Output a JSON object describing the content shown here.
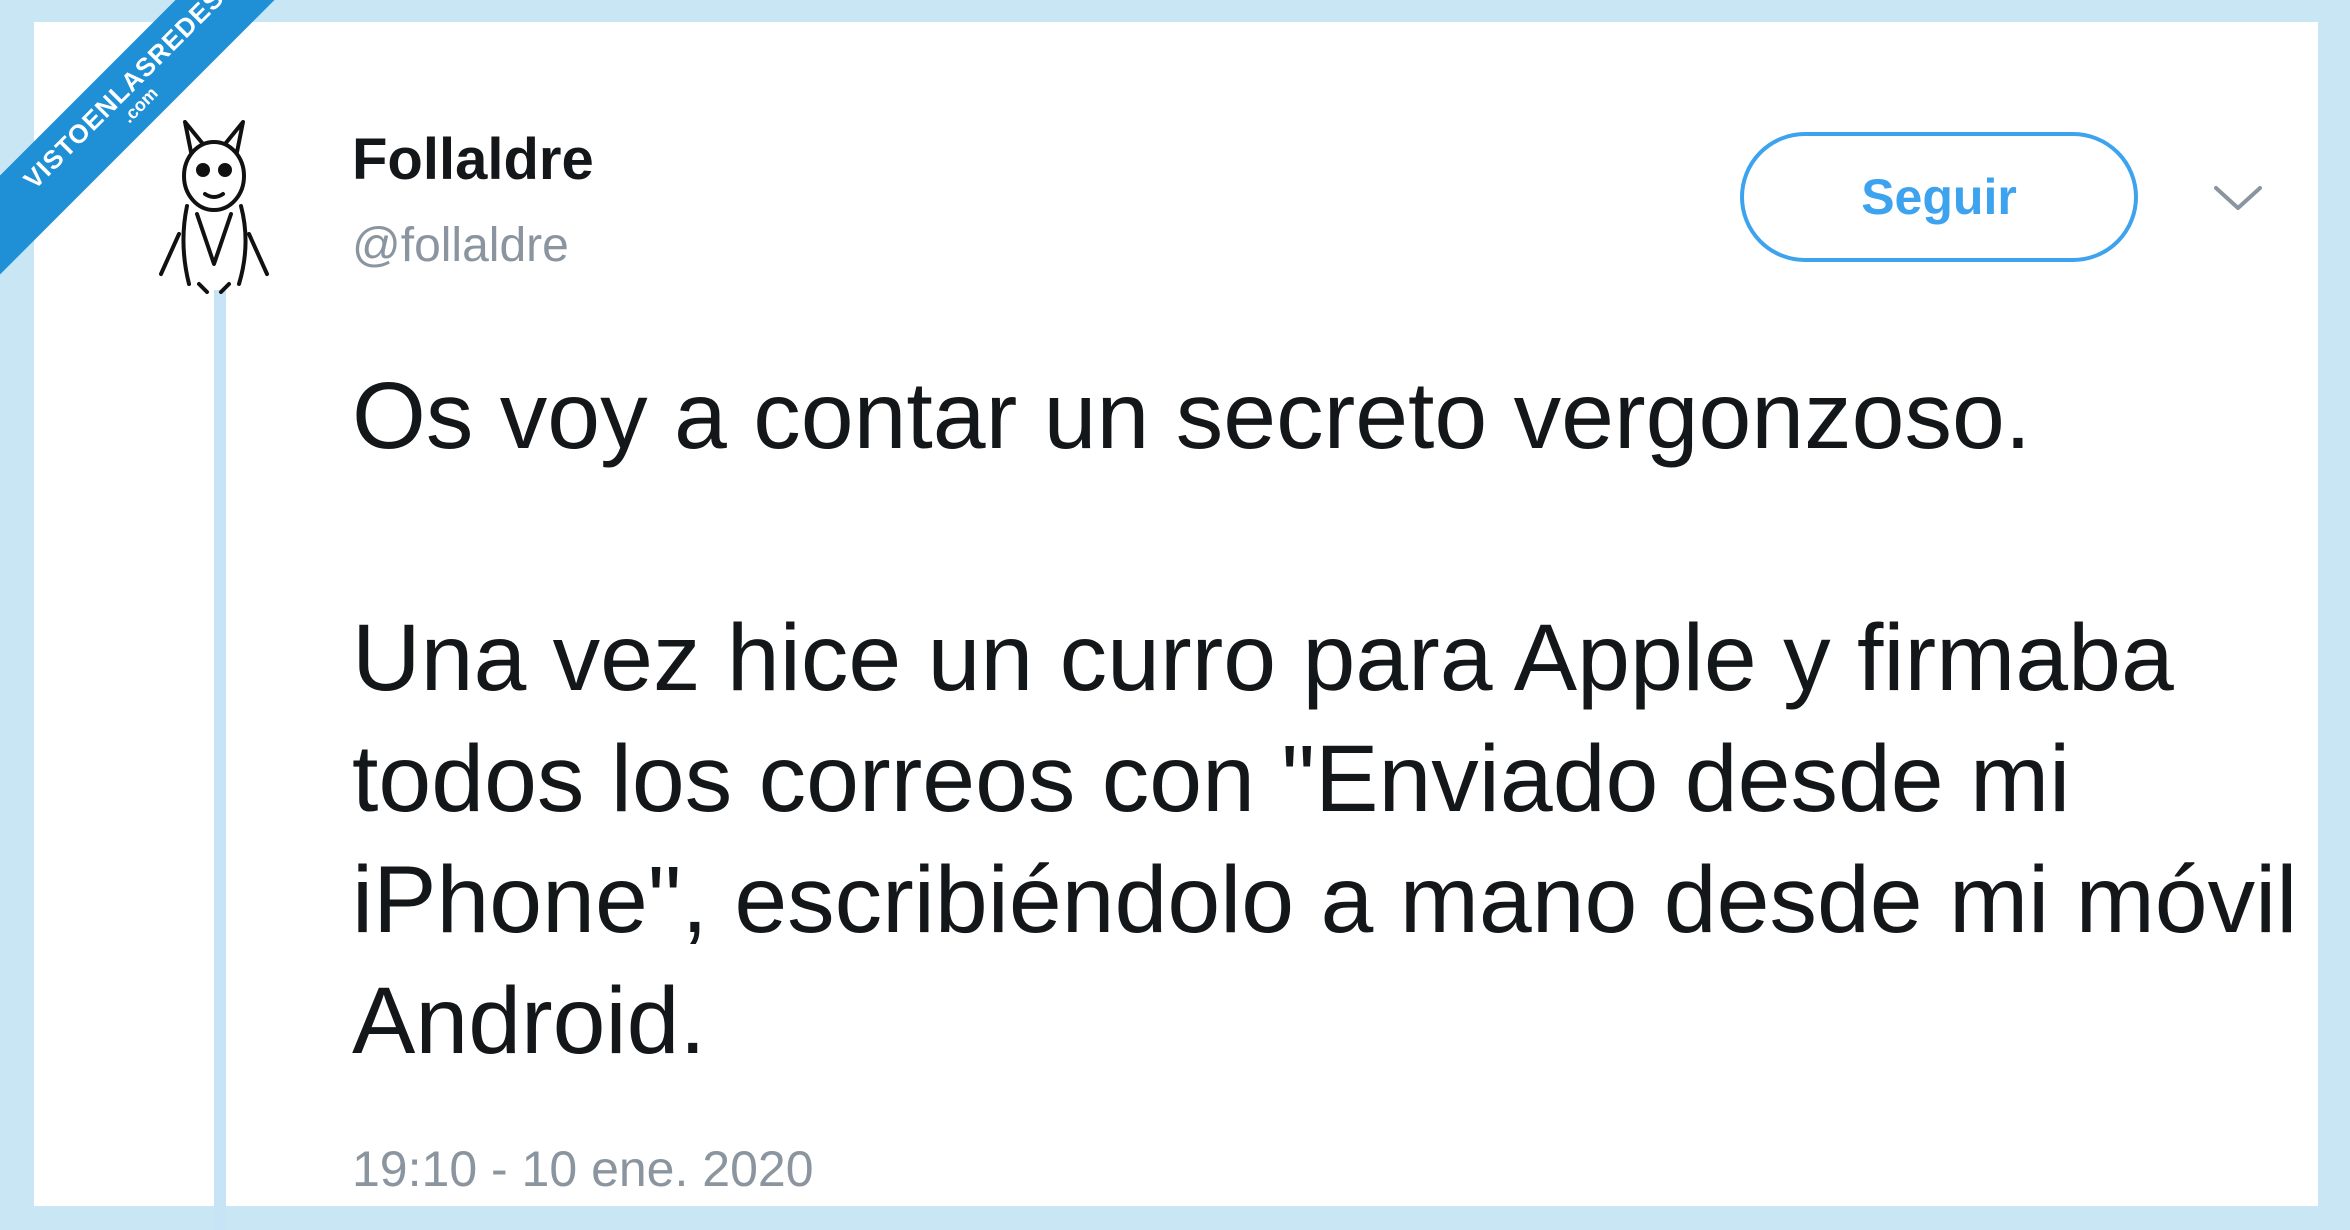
{
  "tweet": {
    "display_name": "Follaldre",
    "handle": "@follaldre",
    "follow_label": "Seguir",
    "menu_icon": "chevron-down-icon",
    "paragraphs": [
      "Os voy a contar un secreto vergonzoso.",
      "Una vez hice un curro para Apple y firmaba todos los correos con \"Enviado desde mi iPhone\", escribiéndolo a mano desde mi móvil Android."
    ],
    "timestamp": "19:10 - 10 ene. 2020"
  },
  "watermark": {
    "main": "VISTOENLASREDES",
    "sub": ".com"
  },
  "colors": {
    "accent": "#3ea3ee",
    "text": "#14171a",
    "muted": "#8a959f",
    "frame": "#c9e6f5",
    "watermark": "#1f8fd6"
  }
}
